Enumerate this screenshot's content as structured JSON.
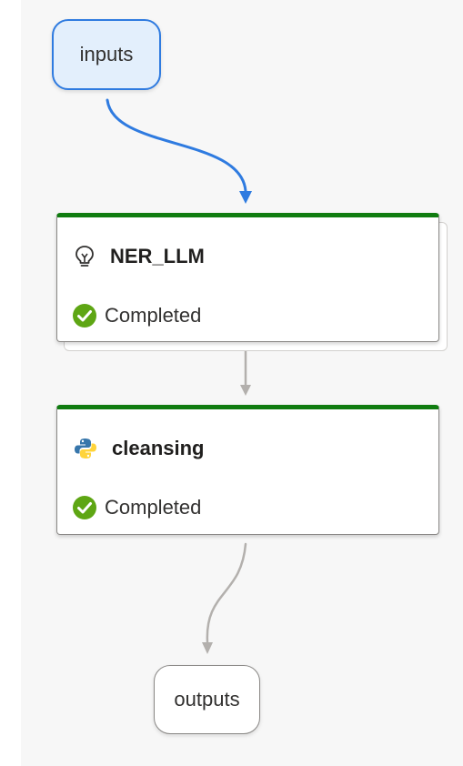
{
  "graph": {
    "inputs_label": "inputs",
    "outputs_label": "outputs",
    "nodes": [
      {
        "name": "NER_LLM",
        "icon": "lightbulb-icon",
        "status": "Completed",
        "status_icon": "check-circle-icon",
        "accent": "#107c10"
      },
      {
        "name": "cleansing",
        "icon": "python-icon",
        "status": "Completed",
        "status_icon": "check-circle-icon",
        "accent": "#107c10"
      }
    ]
  },
  "colors": {
    "selected_border": "#2f7be0",
    "selected_fill": "#e3effc",
    "completed_green": "#107c10",
    "edge_gray": "#b3b0ad",
    "edge_active": "#2f7be0"
  }
}
